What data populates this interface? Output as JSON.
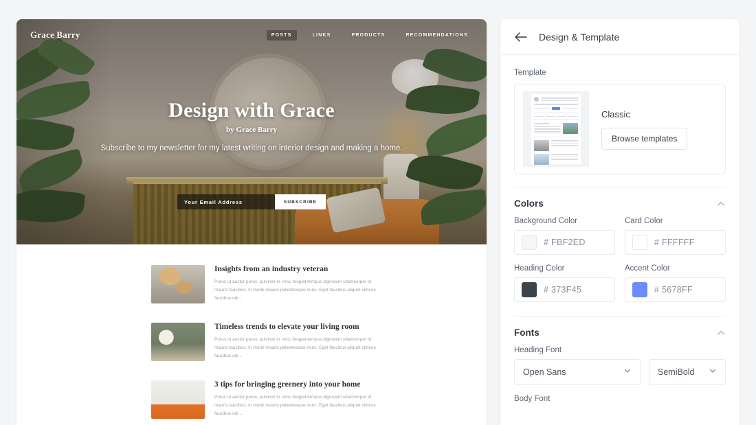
{
  "preview": {
    "brand": "Grace Barry",
    "nav": [
      {
        "label": "POSTS",
        "active": true
      },
      {
        "label": "LINKS",
        "active": false
      },
      {
        "label": "PRODUCTS",
        "active": false
      },
      {
        "label": "RECOMMENDATIONS",
        "active": false
      }
    ],
    "hero": {
      "title": "Design with Grace",
      "byline": "by Grace Barry",
      "description": "Subscribe to my newsletter for my latest writing on interior design and making a home.",
      "email_placeholder": "Your Email Address",
      "subscribe_label": "SUBSCRIBE"
    },
    "posts": [
      {
        "title": "Insights from an industry veteran",
        "excerpt": "Purus ut auctor purus, pulvinar in. Arcu feugiat tempus dignissim ullamcorper id mauris faucibus. In morbi mauris pellentesque nunc. Eget faucibus aliquet ultrices faucibus odi..."
      },
      {
        "title": "Timeless trends to elevate your living room",
        "excerpt": "Purus ut auctor purus, pulvinar in. Arcu feugiat tempus dignissim ullamcorper id mauris faucibus. In morbi mauris pellentesque nunc. Eget faucibus aliquet ultrices faucibus odi..."
      },
      {
        "title": "3 tips for bringing greenery into your home",
        "excerpt": "Purus ut auctor purus, pulvinar in. Arcu feugiat tempus dignissim ullamcorper id mauris faucibus. In morbi mauris pellentesque nunc. Eget faucibus aliquet ultrices faucibus odi..."
      }
    ]
  },
  "panel": {
    "title": "Design & Template",
    "back_icon": "arrow-left-icon",
    "template": {
      "section_label": "Template",
      "name": "Classic",
      "browse_label": "Browse templates",
      "thumbnail_icon": "newsletter-preview-thumbnail"
    },
    "colors": {
      "section_label": "Colors",
      "collapse_icon": "chevron-up-icon",
      "fields": [
        {
          "label": "Background Color",
          "value": "# FBF2ED",
          "swatch": "#F5F6F8"
        },
        {
          "label": "Card Color",
          "value": "# FFFFFF",
          "swatch": "#FFFFFF"
        },
        {
          "label": "Heading Color",
          "value": "# 373F45",
          "swatch": "#3D444B"
        },
        {
          "label": "Accent Color",
          "value": "# 5678FF",
          "swatch": "#6D8BFB"
        }
      ]
    },
    "fonts": {
      "section_label": "Fonts",
      "collapse_icon": "chevron-up-icon",
      "heading_font_label": "Heading Font",
      "heading_font_value": "Open Sans",
      "heading_weight_value": "SemiBold",
      "body_font_label": "Body Font"
    }
  }
}
